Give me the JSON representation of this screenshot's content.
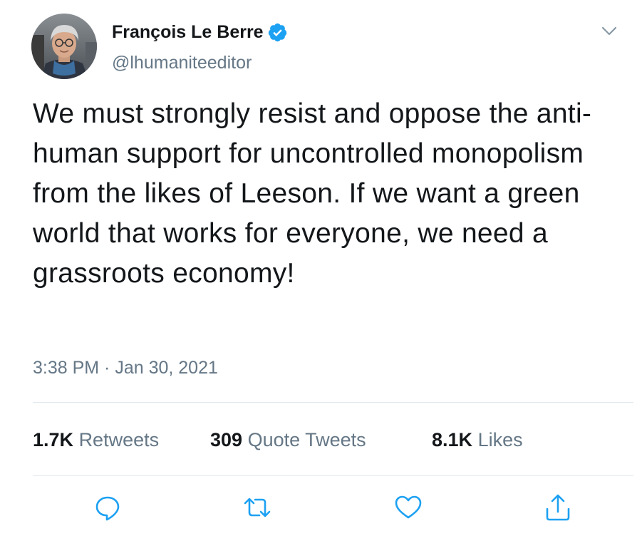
{
  "tweet": {
    "author": {
      "display_name": "François Le Berre",
      "handle": "@lhumaniteeditor",
      "verified": true
    },
    "text": "We must strongly resist and oppose the anti-human support for uncontrolled monopolism from the likes of Leeson. If we want a green world that works for everyone, we need a grassroots economy!",
    "timestamp": "3:38 PM · Jan 30, 2021",
    "stats": {
      "retweets": {
        "count": "1.7K",
        "label": "Retweets"
      },
      "quote_tweets": {
        "count": "309",
        "label": "Quote Tweets"
      },
      "likes": {
        "count": "8.1K",
        "label": "Likes"
      }
    },
    "actions": [
      "reply-icon",
      "retweet-icon",
      "like-icon",
      "share-icon"
    ]
  },
  "colors": {
    "text_primary": "#14171a",
    "text_secondary": "#657786",
    "verified_blue": "#1da1f2",
    "divider": "#e1e8ed"
  }
}
